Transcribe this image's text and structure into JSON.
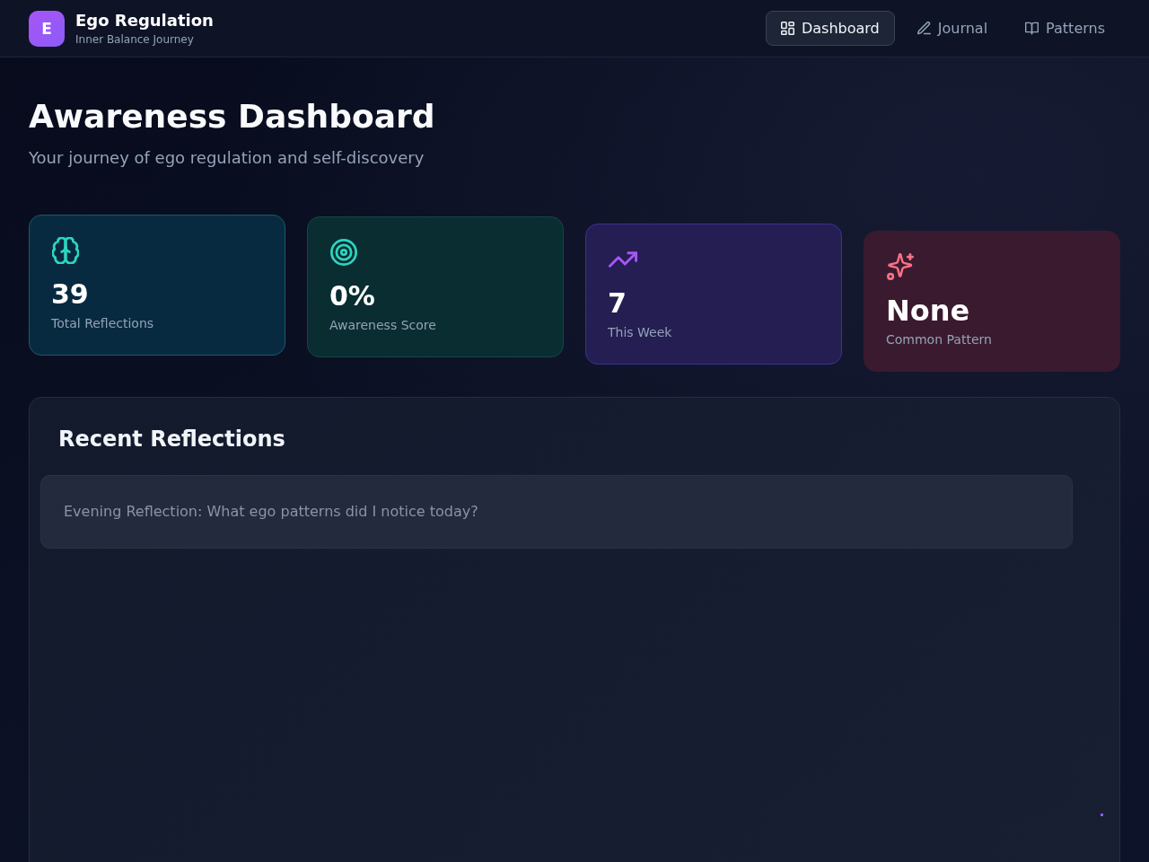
{
  "header": {
    "logo_letter": "E",
    "title": "Ego Regulation",
    "subtitle": "Inner Balance Journey"
  },
  "nav": [
    {
      "label": "Dashboard",
      "kind": "dashboard",
      "selected": true
    },
    {
      "label": "Journal",
      "kind": "journal",
      "selected": false
    },
    {
      "label": "Patterns",
      "kind": "patterns",
      "selected": false
    }
  ],
  "page": {
    "title": "Awareness Dashboard",
    "subtitle": "Your journey of ego regulation and self-discovery"
  },
  "stats": [
    {
      "kind": "reflections",
      "value": "39",
      "label": "Total Reflections"
    },
    {
      "kind": "awareness",
      "value": "0%",
      "label": "Awareness Score"
    },
    {
      "kind": "week",
      "value": "7",
      "label": "This Week"
    },
    {
      "kind": "pattern",
      "value": "None",
      "label": "Common Pattern"
    }
  ],
  "recent": {
    "title": "Recent Reflections",
    "items": [
      {
        "text": "Evening Reflection: What ego patterns did I notice today?"
      }
    ]
  }
}
